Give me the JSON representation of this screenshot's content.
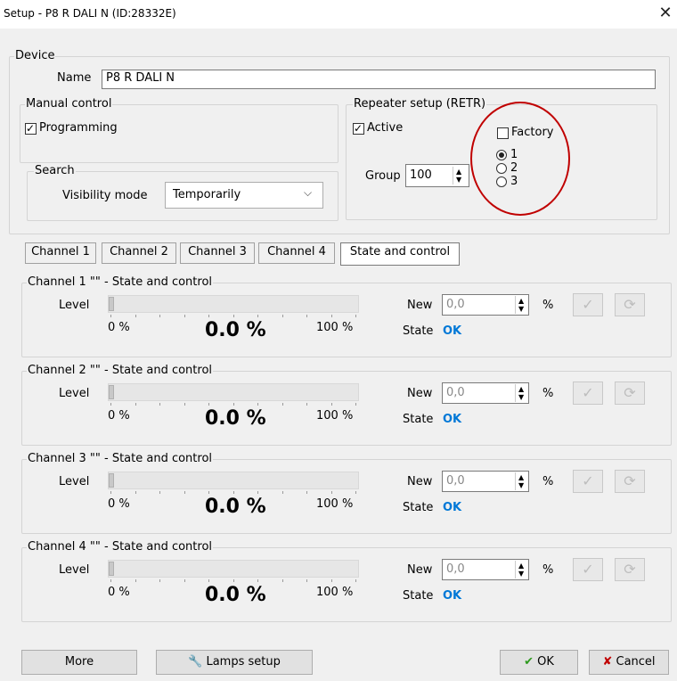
{
  "window": {
    "title": "Setup - P8 R DALI N (ID:28332E)",
    "close_glyph": "✕"
  },
  "device": {
    "legend": "Device",
    "name_label": "Name",
    "name_value": "P8 R DALI N",
    "manual": {
      "legend": "Manual control",
      "programming_label": "Programming",
      "programming_checked": true
    },
    "search": {
      "legend": "Search",
      "visibility_label": "Visibility mode",
      "visibility_value": "Temporarily"
    },
    "repeater": {
      "legend": "Repeater setup (RETR)",
      "active_label": "Active",
      "active_checked": true,
      "factory_label": "Factory",
      "factory_checked": false,
      "options": [
        "1",
        "2",
        "3"
      ],
      "selected_option": "1",
      "group_label": "Group",
      "group_value": "100"
    }
  },
  "tabs": [
    {
      "label": "Channel 1",
      "active": false
    },
    {
      "label": "Channel 2",
      "active": false
    },
    {
      "label": "Channel 3",
      "active": false
    },
    {
      "label": "Channel 4",
      "active": false
    },
    {
      "label": "State and control",
      "active": true
    }
  ],
  "channels": [
    {
      "legend": "Channel 1 \"\" - State and control",
      "level_label": "Level",
      "min_label": "0 %",
      "max_label": "100 %",
      "level_text": "0.0 %",
      "level_fraction": 0.0,
      "new_label": "New",
      "new_value": "0,0",
      "unit": "%",
      "state_label": "State",
      "state_value": "OK"
    },
    {
      "legend": "Channel 2 \"\" - State and control",
      "level_label": "Level",
      "min_label": "0 %",
      "max_label": "100 %",
      "level_text": "0.0 %",
      "level_fraction": 0.0,
      "new_label": "New",
      "new_value": "0,0",
      "unit": "%",
      "state_label": "State",
      "state_value": "OK"
    },
    {
      "legend": "Channel 3 \"\" - State and control",
      "level_label": "Level",
      "min_label": "0 %",
      "max_label": "100 %",
      "level_text": "0.0 %",
      "level_fraction": 0.0,
      "new_label": "New",
      "new_value": "0,0",
      "unit": "%",
      "state_label": "State",
      "state_value": "OK"
    },
    {
      "legend": "Channel 4 \"\" - State and control",
      "level_label": "Level",
      "min_label": "0 %",
      "max_label": "100 %",
      "level_text": "0.0 %",
      "level_fraction": 0.0,
      "new_label": "New",
      "new_value": "0,0",
      "unit": "%",
      "state_label": "State",
      "state_value": "OK"
    }
  ],
  "buttons": {
    "more": "More",
    "lamps": "Lamps setup",
    "ok": "OK",
    "cancel": "Cancel"
  },
  "colors": {
    "accent_ok": "#0078d7",
    "annotation_circle": "#c00000",
    "ok_check": "#2e9a1e",
    "cancel_x": "#c00000"
  }
}
